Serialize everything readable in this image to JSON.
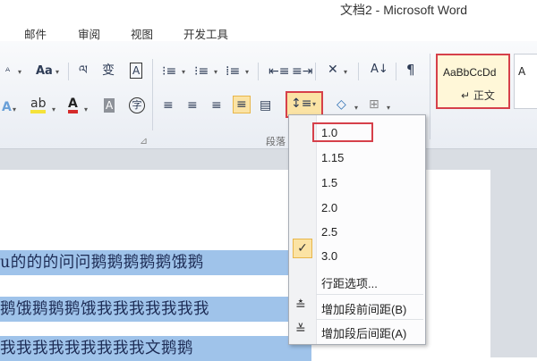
{
  "window": {
    "title": "文档2 - Microsoft Word"
  },
  "tabs": [
    "邮件",
    "审阅",
    "视图",
    "开发工具"
  ],
  "ribbon": {
    "paragraph_group_label": "段落",
    "icons": [
      "font-size-icon",
      "change-case-icon",
      "phonetic-guide-icon",
      "char-border-icon",
      "bullets-icon",
      "numbering-icon",
      "multilevel-list-icon",
      "decrease-indent-icon",
      "increase-indent-icon",
      "chinese-layout-icon",
      "sort-icon",
      "show-marks-icon",
      "text-effect-icon",
      "highlight-icon",
      "font-color-icon",
      "char-shading-icon",
      "enclose-char-icon",
      "align-left-icon",
      "align-center-icon",
      "align-right-icon",
      "justify-icon",
      "distributed-icon",
      "line-spacing-icon",
      "shading-icon",
      "borders-icon"
    ],
    "styles": {
      "preview": "AaBbCcDd",
      "name": "正文"
    }
  },
  "line_spacing_menu": {
    "options": [
      "1.0",
      "1.15",
      "1.5",
      "2.0",
      "2.5",
      "3.0"
    ],
    "checked": "3.0",
    "highlighted": "1.0",
    "more_options": "行距选项...",
    "add_space_before": "增加段前间距(B)",
    "add_space_after": "增加段后间距(A)"
  },
  "document": {
    "lines": [
      "u的的的问问鹅鹅鹅鹅鹅饿鹅",
      "鹅饿鹅鹅鹅饿我我我我我我我",
      "我我我我我我我我我文鹅鹅"
    ]
  },
  "colors": {
    "selection": "#9fc3ea",
    "highlight_border": "#d6404a",
    "hover_fill": "#fbe3a4"
  }
}
